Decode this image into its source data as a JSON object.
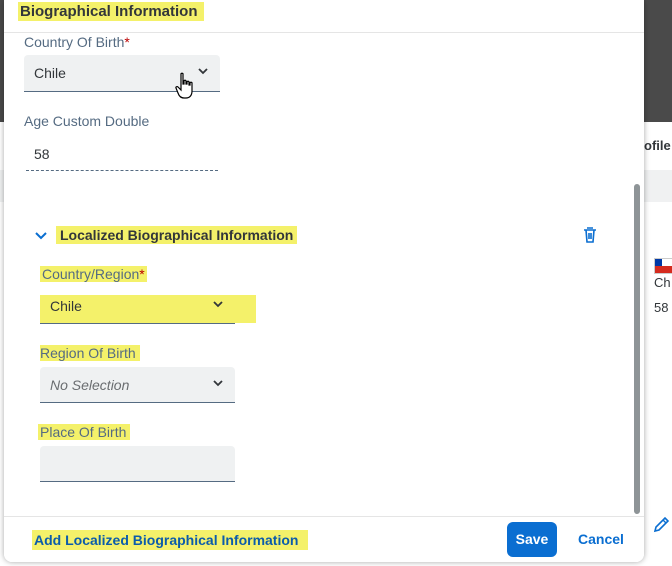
{
  "background": {
    "partial_texts": [
      "ofile",
      "Ch",
      "58"
    ]
  },
  "dialog": {
    "title": "Biographical Information",
    "fields": {
      "country_of_birth": {
        "label": "Country Of Birth",
        "required_marker": "*",
        "value": "Chile"
      },
      "age_custom_double": {
        "label": "Age Custom Double",
        "value": "58"
      }
    },
    "localized_section": {
      "title": "Localized Biographical Information",
      "country_region": {
        "label": "Country/Region",
        "required_marker": "*",
        "value": "Chile"
      },
      "region_of_birth": {
        "label": "Region Of Birth",
        "value": "No Selection"
      },
      "place_of_birth": {
        "label": "Place Of Birth",
        "value": ""
      }
    },
    "footer": {
      "add_link": "Add Localized Biographical Information",
      "save": "Save",
      "cancel": "Cancel"
    }
  },
  "icons": {
    "dropdown": "chevron-down-icon",
    "collapse": "chevron-down-icon",
    "delete": "trash-icon",
    "edit": "pencil-icon",
    "pointer": "hand-cursor-icon",
    "flag": "chile-flag-icon"
  },
  "colors": {
    "accent": "#0a6ed1",
    "highlight": "#f4f16a",
    "required": "#bb0000"
  }
}
